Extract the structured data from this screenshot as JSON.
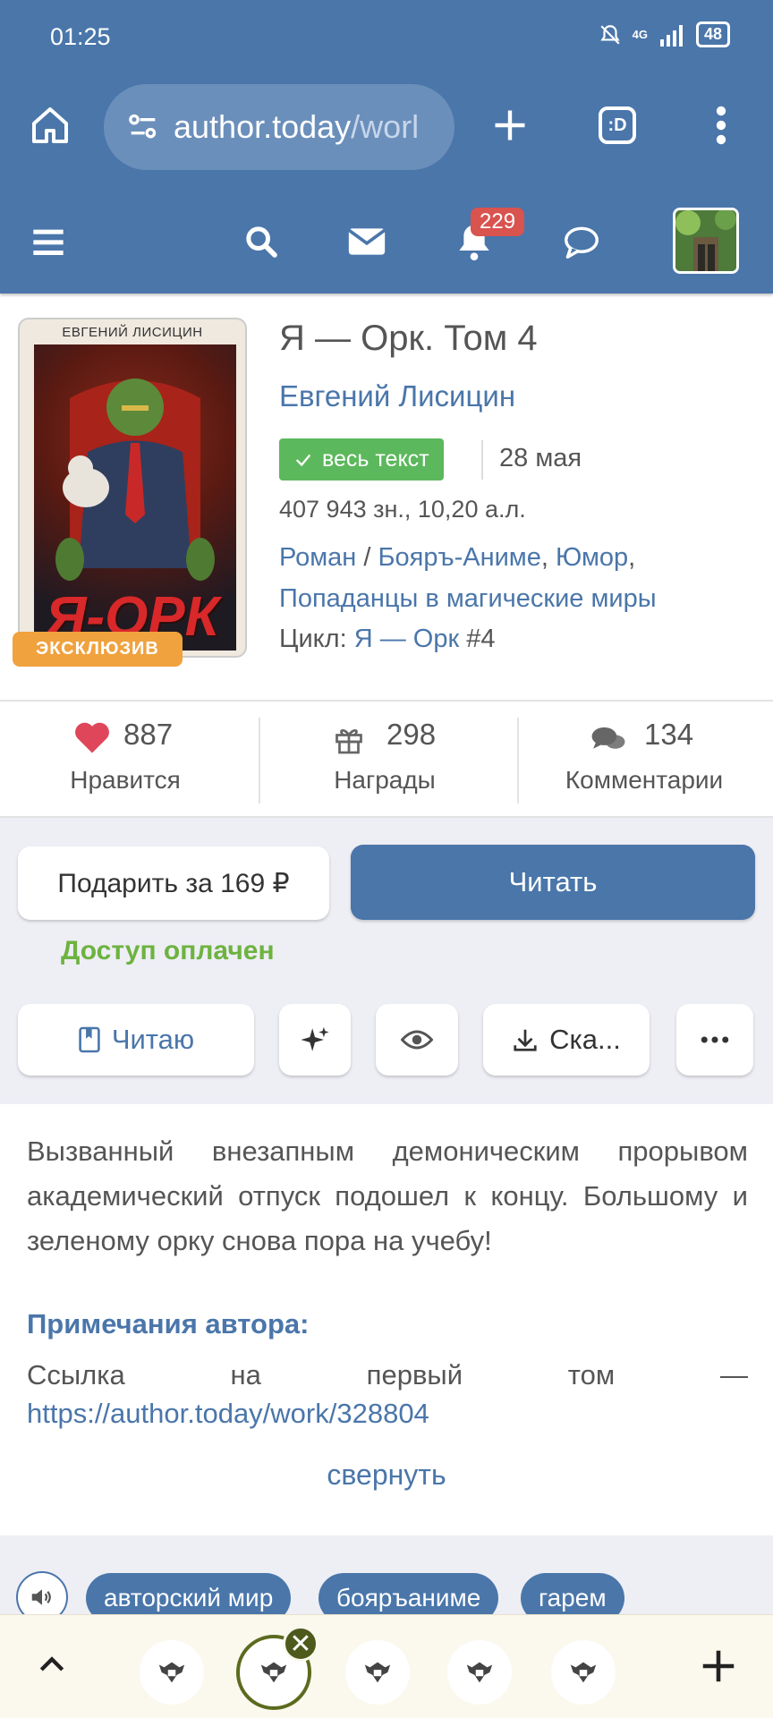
{
  "status": {
    "time": "01:25",
    "network": "4G",
    "battery": "48"
  },
  "browser": {
    "url_main": "author.today",
    "url_dim": "/worl",
    "tab_count_label": ":D"
  },
  "header": {
    "notifications_count": "229"
  },
  "book": {
    "cover_author": "ЕВГЕНИЙ ЛИСИЦИН",
    "cover_title": "Я-ОРК",
    "exclusive_label": "ЭКСКЛЮЗИВ",
    "title": "Я — Орк. Том 4",
    "author": "Евгений Лисицин",
    "fulltext_label": "весь текст",
    "date": "28 мая",
    "volume": "407 943 зн., 10,20 а.л.",
    "genre_1": "Роман",
    "genre_sep": " / ",
    "genre_2": "Бояръ-Аниме",
    "genre_3": "Юмор",
    "genre_4": "Попаданцы в магические миры",
    "cycle_label": "Цикл: ",
    "cycle_link": "Я — Орк",
    "cycle_number": " #4"
  },
  "stats": {
    "likes": {
      "value": "887",
      "label": "Нравится"
    },
    "awards": {
      "value": "298",
      "label": "Награды"
    },
    "comments": {
      "value": "134",
      "label": "Комментарии"
    }
  },
  "actions": {
    "gift_label": "Подарить за 169 ₽",
    "read_label": "Читать",
    "paid_label": "Доступ оплачен",
    "reading_label": "Читаю",
    "download_label": "Ска..."
  },
  "description": {
    "text": "Вызванный внезапным демоническим прорывом академический отпуск подошел к концу. Большому и зеленому орку снова пора на учебу!",
    "notes_heading": "Примечания автора:",
    "notes_text": "Ссылка на первый том —",
    "notes_link": "https://author.today/work/328804",
    "collapse_label": "свернуть"
  },
  "tags": [
    "авторский мир",
    "бояръаниме",
    "гарем"
  ],
  "colors": {
    "brand": "#4a76aa",
    "success": "#5cb85c",
    "paid": "#6db33f",
    "badge": "#d9534f",
    "exclusive": "#f0a23e"
  }
}
